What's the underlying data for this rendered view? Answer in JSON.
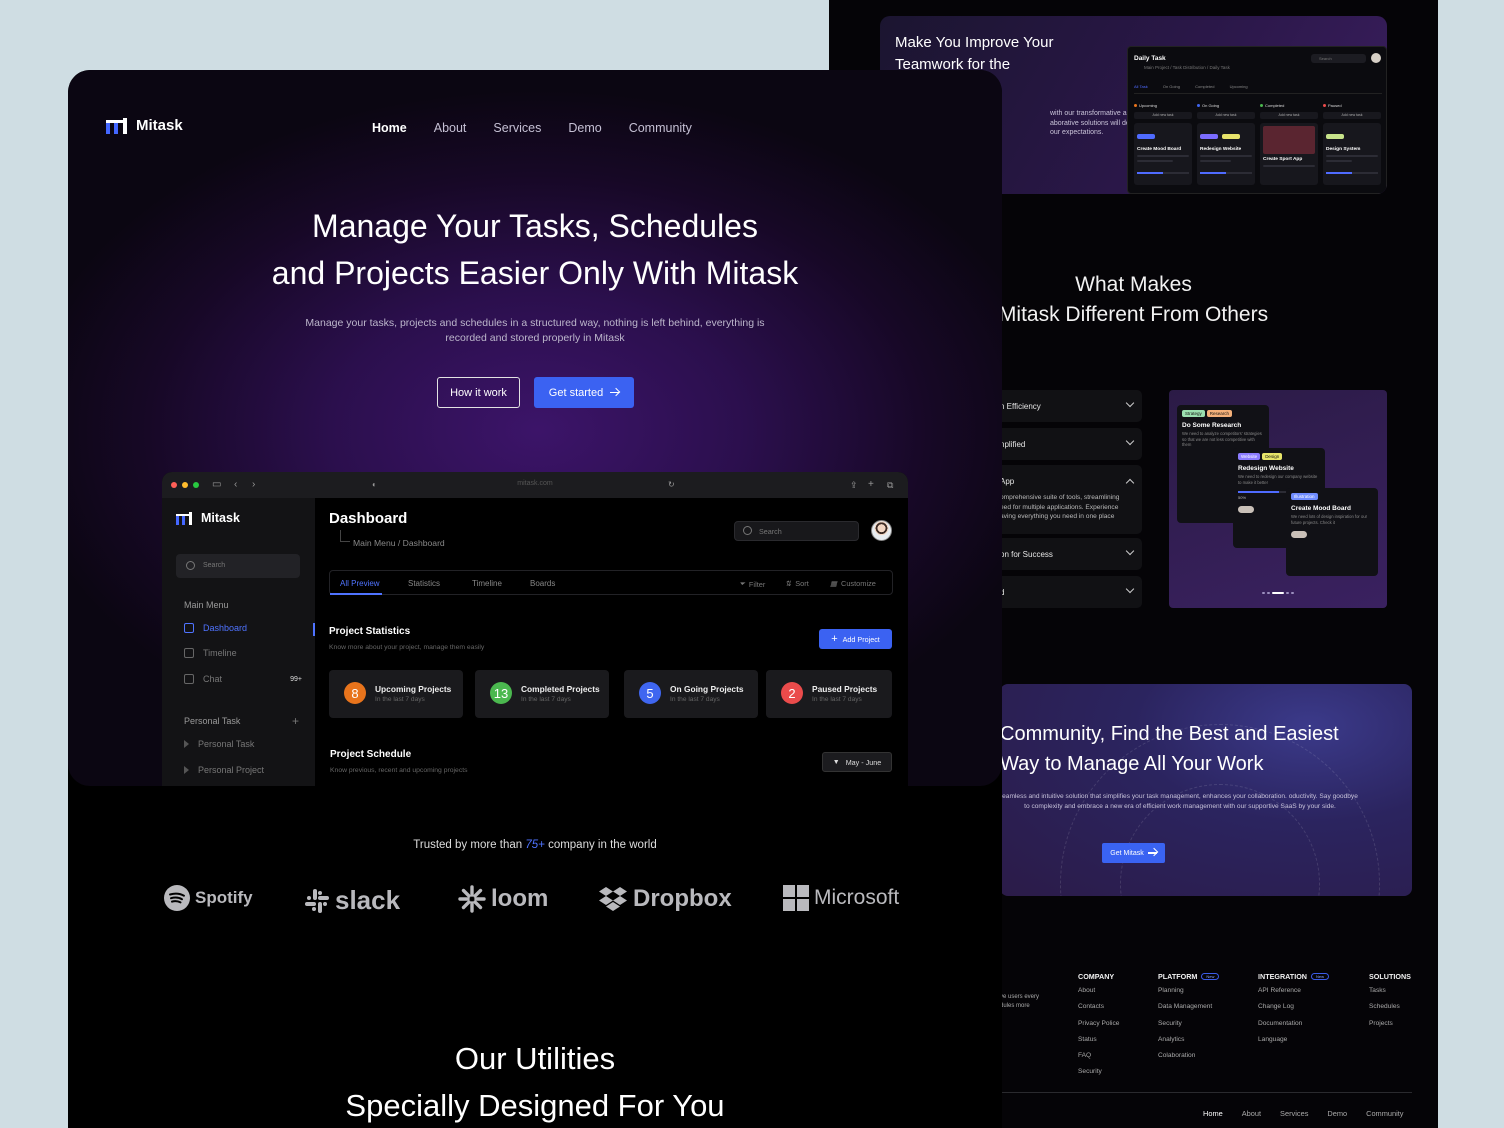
{
  "front": {
    "brand": "Mitask",
    "nav": [
      "Home",
      "About",
      "Services",
      "Demo",
      "Community"
    ],
    "hero": {
      "title_line1": "Manage Your Tasks, Schedules",
      "title_line2": "and Projects Easier Only With Mitask",
      "lead": "Manage your tasks, projects and schedules in a structured way, nothing is left behind, everything is recorded and stored properly in Mitask",
      "btn_secondary": "How it work",
      "btn_primary": "Get started"
    },
    "browser": {
      "url": "mitask.com",
      "sidebar": {
        "brand": "Mitask",
        "search_placeholder": "Search",
        "main_menu": "Main Menu",
        "items": [
          {
            "label": "Dashboard",
            "badge": ""
          },
          {
            "label": "Timeline",
            "badge": ""
          },
          {
            "label": "Chat",
            "badge": "99+"
          }
        ],
        "personal_task": "Personal Task",
        "sub_items": [
          "Personal Task",
          "Personal Project"
        ]
      },
      "dashboard": {
        "title": "Dashboard",
        "breadcrumb": "Main Menu / Dashboard",
        "search_placeholder": "Search",
        "tabs": [
          "All Preview",
          "Statistics",
          "Timeline",
          "Boards"
        ],
        "tools": [
          "Filter",
          "Sort",
          "Customize"
        ],
        "stats_title": "Project Statistics",
        "stats_subtitle": "Know more about your project, manage them easily",
        "add_project": "Add Project",
        "stats": [
          {
            "count": "8",
            "label": "Upcoming Projects",
            "sub": "In the last 7 days",
            "color": "#e8741c"
          },
          {
            "count": "13",
            "label": "Completed Projects",
            "sub": "In the last 7 days",
            "color": "#4bb84f"
          },
          {
            "count": "5",
            "label": "On Going Projects",
            "sub": "In the last 7 days",
            "color": "#3f66f0"
          },
          {
            "count": "2",
            "label": "Paused Projects",
            "sub": "In the last 7 days",
            "color": "#ea4b4b"
          }
        ],
        "schedule_title": "Project Schedule",
        "schedule_subtitle": "Know previous, recent and upcoming projects",
        "schedule_range": "May - June"
      }
    },
    "trusted_prefix": "Trusted by more than",
    "trusted_count": "75+",
    "trusted_suffix": "company in the world",
    "logos": [
      "Spotify",
      "slack",
      "loom",
      "Dropbox",
      "Microsoft"
    ],
    "utilities_line1": "Our Utilities",
    "utilities_line2": "Specially Designed For You"
  },
  "back": {
    "hero_title": "Make You Improve Your Teamwork for the",
    "hero_text": "with our transformative approach. aborative solutions will delivering our expectations.",
    "board": {
      "title": "Daily Task",
      "breadcrumb": "Main Project / Task Distribution / Daily Task",
      "search": "Search",
      "tabs": [
        "All Task",
        "On Going",
        "Completed",
        "Upcoming"
      ],
      "columns": [
        {
          "label": "Upcoming",
          "card": "Create Mood Board",
          "color": "#e8741c"
        },
        {
          "label": "On Going",
          "card": "Redesign Website",
          "color": "#3f66f0"
        },
        {
          "label": "Completed",
          "card": "Create Sport App",
          "color": "#4bb84f"
        },
        {
          "label": "Paused",
          "card": "Design System",
          "color": "#ea4b4b"
        }
      ],
      "add_label": "Add new task"
    },
    "diff_line1": "What Makes",
    "diff_line2": "Mitask Different From Others",
    "accordion": [
      "n Efficiency",
      "nplified",
      "App",
      "on for Success",
      "d"
    ],
    "accordion_open_text": "omprehensive suite of tools, streamlining eed for multiple applications. Experience aving everything you need in one place",
    "feature_cards": [
      {
        "tags": [
          "Strategy",
          "Research"
        ],
        "title": "Do Some Research",
        "desc": "We need to analyze competitors' strategies so that we are not less competitive with them"
      },
      {
        "tags": [
          "Website",
          "Design"
        ],
        "title": "Redesign Website",
        "desc": "We need to redesign our company website to make it better",
        "progress": "50%"
      },
      {
        "tags": [
          "Illustration"
        ],
        "title": "Create Mood Board",
        "desc": "We need lots of design inspiration for our future projects. Check it"
      }
    ],
    "cta": {
      "title_line1": "Community, Find the Best and Easiest",
      "title_line2": "Way to Manage All Your Work",
      "text": "eamless and intuitive solution that simplifies your task management, enhances your collaboration. oductivity. Say goodbye to complexity and embrace a new era of efficient work management with our supportive SaaS by your side.",
      "button": "Get Mitask"
    },
    "footer_left": "ve users every dules more",
    "footer_cols": [
      {
        "title": "COMPANY",
        "new": "",
        "links": [
          "About",
          "Contacts",
          "Privacy Police",
          "Status",
          "FAQ",
          "Security"
        ]
      },
      {
        "title": "PLATFORM",
        "new": "New",
        "links": [
          "Planning",
          "Data Management",
          "Security",
          "Analytics",
          "Colaboration"
        ]
      },
      {
        "title": "INTEGRATION",
        "new": "New",
        "links": [
          "API Reference",
          "Change Log",
          "Documentation",
          "Language"
        ]
      },
      {
        "title": "SOLUTIONS",
        "new": "",
        "links": [
          "Tasks",
          "Schedules",
          "Projects"
        ]
      }
    ],
    "footer_nav": [
      "Home",
      "About",
      "Services",
      "Demo",
      "Community"
    ]
  }
}
